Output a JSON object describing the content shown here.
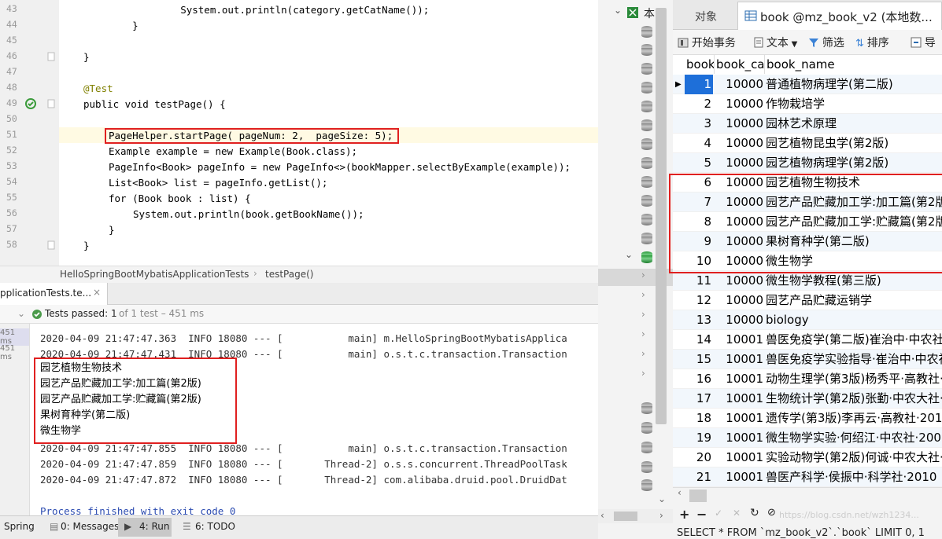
{
  "editor": {
    "lines": [
      {
        "n": "43",
        "code": "        System.out.println(category.getCatName());"
      },
      {
        "n": "44",
        "code": "    }"
      },
      {
        "n": "45",
        "code": ""
      },
      {
        "n": "46",
        "code": "}"
      },
      {
        "n": "47",
        "code": ""
      },
      {
        "n": "48",
        "code": "@Test"
      },
      {
        "n": "49",
        "code": "public void testPage() {"
      },
      {
        "n": "50",
        "code": ""
      },
      {
        "n": "51",
        "code": "PageHelper.startPage( pageNum: 2,  pageSize: 5);"
      },
      {
        "n": "52",
        "code": "Example example = new Example(Book.class);"
      },
      {
        "n": "53",
        "code": "PageInfo<Book> pageInfo = new PageInfo<>(bookMapper.selectByExample(example));"
      },
      {
        "n": "54",
        "code": "List<Book> list = pageInfo.getList();"
      },
      {
        "n": "55",
        "code": "for (Book book : list) {"
      },
      {
        "n": "56",
        "code": "System.out.println(book.getBookName());"
      },
      {
        "n": "57",
        "code": "}"
      },
      {
        "n": "58",
        "code": "}"
      }
    ],
    "breadcrumb": [
      "HelloSpringBootMybatisApplicationTests",
      "testPage()"
    ]
  },
  "run": {
    "tab_label": "pplicationTests.te...",
    "status": "Tests passed: 1",
    "status_detail": "of 1 test – 451 ms",
    "time_a": "451 ms",
    "time_b": "451 ms",
    "log_top": [
      "2020-04-09 21:47:47.363  INFO 18080 --- [           main] m.HelloSpringBootMybatisApplica",
      "2020-04-09 21:47:47.431  INFO 18080 --- [           main] o.s.t.c.transaction.Transaction"
    ],
    "output": [
      "园艺植物生物技术",
      "园艺产品贮藏加工学:加工篇(第2版)",
      "园艺产品贮藏加工学:贮藏篇(第2版)",
      "果树育种学(第二版)",
      "微生物学"
    ],
    "log_bottom": [
      "2020-04-09 21:47:47.855  INFO 18080 --- [           main] o.s.t.c.transaction.Transaction",
      "2020-04-09 21:47:47.859  INFO 18080 --- [       Thread-2] o.s.s.concurrent.ThreadPoolTask",
      "2020-04-09 21:47:47.872  INFO 18080 --- [       Thread-2] com.alibaba.druid.pool.DruidDat"
    ],
    "exit_text": "Process finished with exit code 0"
  },
  "bottom_tabs": {
    "spring": "Spring",
    "messages": "0: Messages",
    "run": "4: Run",
    "todo": "6: TODO"
  },
  "db": {
    "tree_label": "本",
    "tab_objects": "对象",
    "tab_table": "book @mz_book_v2 (本地数...",
    "toolbar": {
      "begin": "开始事务",
      "text": "文本",
      "filter": "筛选",
      "sort": "排序",
      "export": "导"
    },
    "columns": [
      "book",
      "book_ca",
      "book_name"
    ],
    "rows": [
      {
        "id": "1",
        "cat": "10000",
        "name": "普通植物病理学(第二版)"
      },
      {
        "id": "2",
        "cat": "10000",
        "name": "作物栽培学"
      },
      {
        "id": "3",
        "cat": "10000",
        "name": "园林艺术原理"
      },
      {
        "id": "4",
        "cat": "10000",
        "name": "园艺植物昆虫学(第2版)"
      },
      {
        "id": "5",
        "cat": "10000",
        "name": "园艺植物病理学(第2版)"
      },
      {
        "id": "6",
        "cat": "10000",
        "name": "园艺植物生物技术"
      },
      {
        "id": "7",
        "cat": "10000",
        "name": "园艺产品贮藏加工学:加工篇(第2版"
      },
      {
        "id": "8",
        "cat": "10000",
        "name": "园艺产品贮藏加工学:贮藏篇(第2版"
      },
      {
        "id": "9",
        "cat": "10000",
        "name": "果树育种学(第二版)"
      },
      {
        "id": "10",
        "cat": "10000",
        "name": "微生物学"
      },
      {
        "id": "11",
        "cat": "10000",
        "name": "微生物学教程(第三版)"
      },
      {
        "id": "12",
        "cat": "10000",
        "name": "园艺产品贮藏运销学"
      },
      {
        "id": "13",
        "cat": "10000",
        "name": "biology"
      },
      {
        "id": "14",
        "cat": "10001",
        "name": "兽医免疫学(第二版)崔治中·中农社"
      },
      {
        "id": "15",
        "cat": "10001",
        "name": "兽医免疫学实验指导·崔治中·中农社"
      },
      {
        "id": "16",
        "cat": "10001",
        "name": "动物生理学(第3版)杨秀平·高教社·2"
      },
      {
        "id": "17",
        "cat": "10001",
        "name": "生物统计学(第2版)张勤·中农大社·2"
      },
      {
        "id": "18",
        "cat": "10001",
        "name": "遗传学(第3版)李再云·高教社·2017"
      },
      {
        "id": "19",
        "cat": "10001",
        "name": "微生物学实验·何绍江·中农社·2007"
      },
      {
        "id": "20",
        "cat": "10001",
        "name": "实验动物学(第2版)何诚·中农大社·2"
      },
      {
        "id": "21",
        "cat": "10001",
        "name": "兽医产科学·侯振中·科学社·2010"
      }
    ],
    "watermark": "https://blog.csdn.net/wzh1234...",
    "sql": "SELECT * FROM `mz_book_v2`.`book` LIMIT 0, 1"
  },
  "colors": {
    "highlight_box": "#e02020",
    "selected_row": "#1e6fd9",
    "line_highlight": "#fffae3"
  }
}
